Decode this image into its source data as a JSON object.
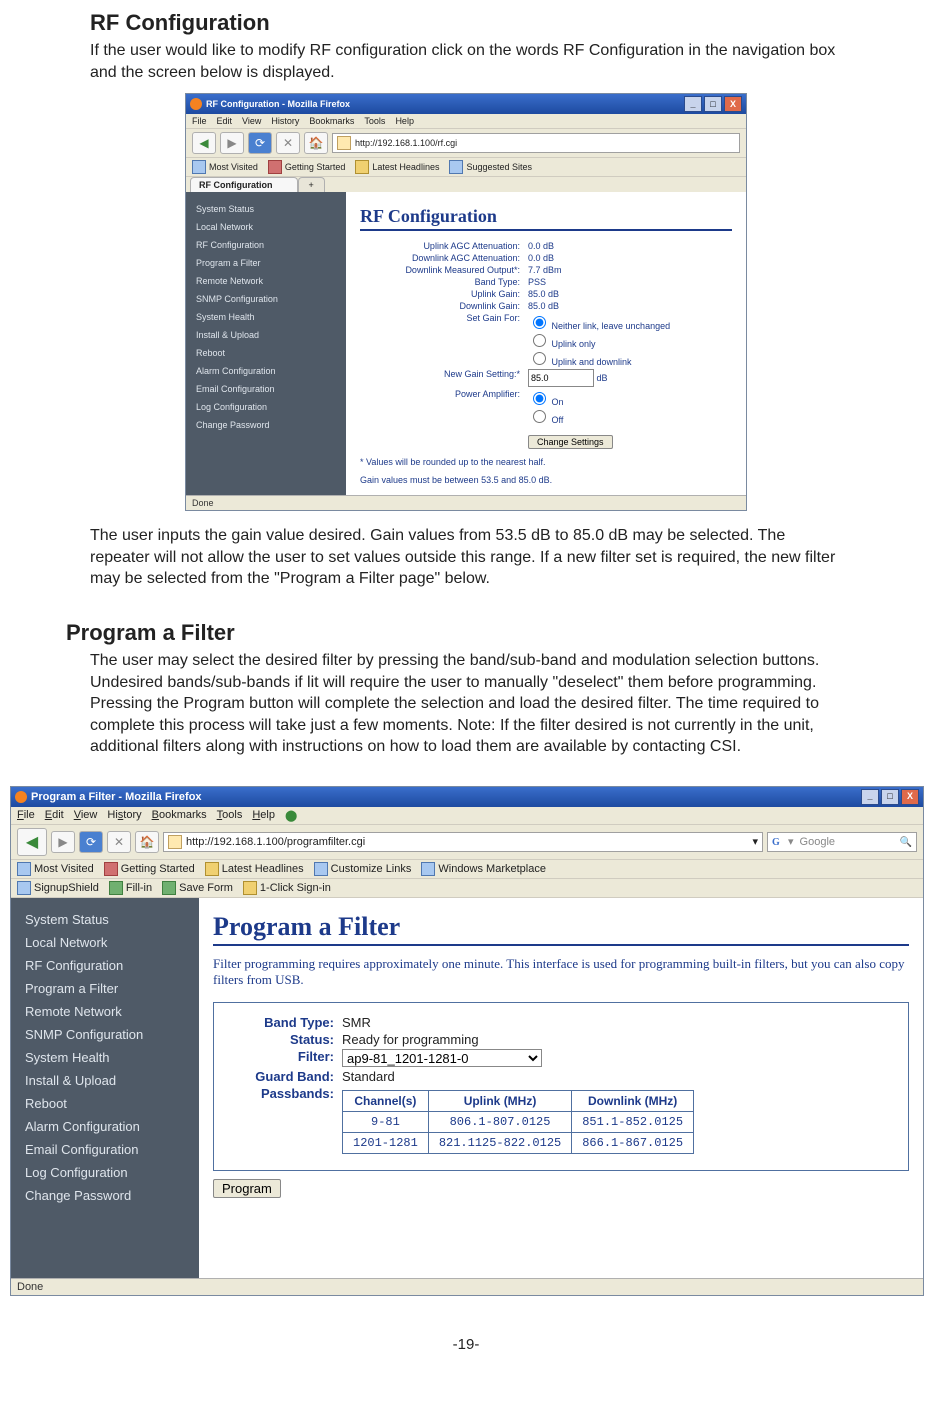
{
  "section1": {
    "heading": "RF Configuration",
    "intro": "If the user would like to modify RF configuration click on the words RF Configuration in the navigation box and the screen below is displayed.",
    "after": "The user inputs the gain value desired. Gain values from 53.5 dB to 85.0 dB may be selected. The repeater will not allow the user to set values outside this range. If a new filter set is required, the new filter may be selected from the \"Program a Filter page\" below."
  },
  "section2": {
    "heading": "Program a Filter",
    "intro": "The user may select the desired filter by pressing the band/sub-band and modulation selection buttons. Undesired bands/sub-bands if lit will require the user to manually \"deselect\" them before programming.   Pressing the Program button will complete the selection and load the desired filter. The time required to complete this process will take just a few moments.  Note: If the filter desired is not currently in the unit, additional filters along with instructions on how to load them are available by contacting CSI."
  },
  "page_number": "-19-",
  "nav_items": [
    "System Status",
    "Local Network",
    "RF Configuration",
    "Program a Filter",
    "Remote Network",
    "SNMP Configuration",
    "System Health",
    "Install & Upload",
    "Reboot",
    "Alarm Configuration",
    "Email Configuration",
    "Log Configuration",
    "Change Password"
  ],
  "screenshot1": {
    "title": "RF Configuration - Mozilla Firefox",
    "menubar": [
      "File",
      "Edit",
      "View",
      "History",
      "Bookmarks",
      "Tools",
      "Help"
    ],
    "url": "http://192.168.1.100/rf.cgi",
    "bookmarks": [
      "Most Visited",
      "Getting Started",
      "Latest Headlines",
      "Suggested Sites"
    ],
    "tab": "RF Configuration",
    "pane_title": "RF Configuration",
    "rows": {
      "uplink_agc_label": "Uplink AGC Attenuation:",
      "uplink_agc_val": "0.0 dB",
      "downlink_agc_label": "Downlink AGC Attenuation:",
      "downlink_agc_val": "0.0 dB",
      "dmo_label": "Downlink Measured Output*:",
      "dmo_val": "7.7 dBm",
      "band_type_label": "Band Type:",
      "band_type_val": "PSS",
      "uplink_gain_label": "Uplink Gain:",
      "uplink_gain_val": "85.0 dB",
      "downlink_gain_label": "Downlink Gain:",
      "downlink_gain_val": "85.0 dB",
      "set_gain_label": "Set Gain For:",
      "radio1": "Neither link, leave unchanged",
      "radio2": "Uplink only",
      "radio3": "Uplink and downlink",
      "new_gain_label": "New Gain Setting:*",
      "new_gain_val": "85.0",
      "new_gain_unit": "dB",
      "power_amp_label": "Power Amplifier:",
      "pa_on": "On",
      "pa_off": "Off",
      "button": "Change Settings",
      "foot1": "* Values will be rounded up to the nearest half.",
      "foot2": "Gain values must be between 53.5 and 85.0 dB."
    },
    "status": "Done"
  },
  "screenshot2": {
    "title": "Program a Filter - Mozilla Firefox",
    "menubar": [
      "File",
      "Edit",
      "View",
      "History",
      "Bookmarks",
      "Tools",
      "Help"
    ],
    "url": "http://192.168.1.100/programfilter.cgi",
    "search_placeholder": "Google",
    "bookmarks1": [
      "Most Visited",
      "Getting Started",
      "Latest Headlines",
      "Customize Links",
      "Windows Marketplace"
    ],
    "bookmarks2": [
      "SignupShield",
      "Fill-in",
      "Save Form",
      "1-Click Sign-in"
    ],
    "pane_title": "Program a Filter",
    "subtext": "Filter programming requires approximately one minute. This interface is used for programming built-in filters, but you can also copy filters from USB.",
    "box": {
      "band_type_label": "Band Type:",
      "band_type_val": "SMR",
      "status_label": "Status:",
      "status_val": "Ready for programming",
      "filter_label": "Filter:",
      "filter_val": "ap9-81_1201-1281-0",
      "guard_label": "Guard Band:",
      "guard_val": "Standard",
      "passbands_label": "Passbands:",
      "table_headers": [
        "Channel(s)",
        "Uplink (MHz)",
        "Downlink (MHz)"
      ],
      "table_rows": [
        [
          "9-81",
          "806.1-807.0125",
          "851.1-852.0125"
        ],
        [
          "1201-1281",
          "821.1125-822.0125",
          "866.1-867.0125"
        ]
      ]
    },
    "button": "Program",
    "status": "Done"
  }
}
